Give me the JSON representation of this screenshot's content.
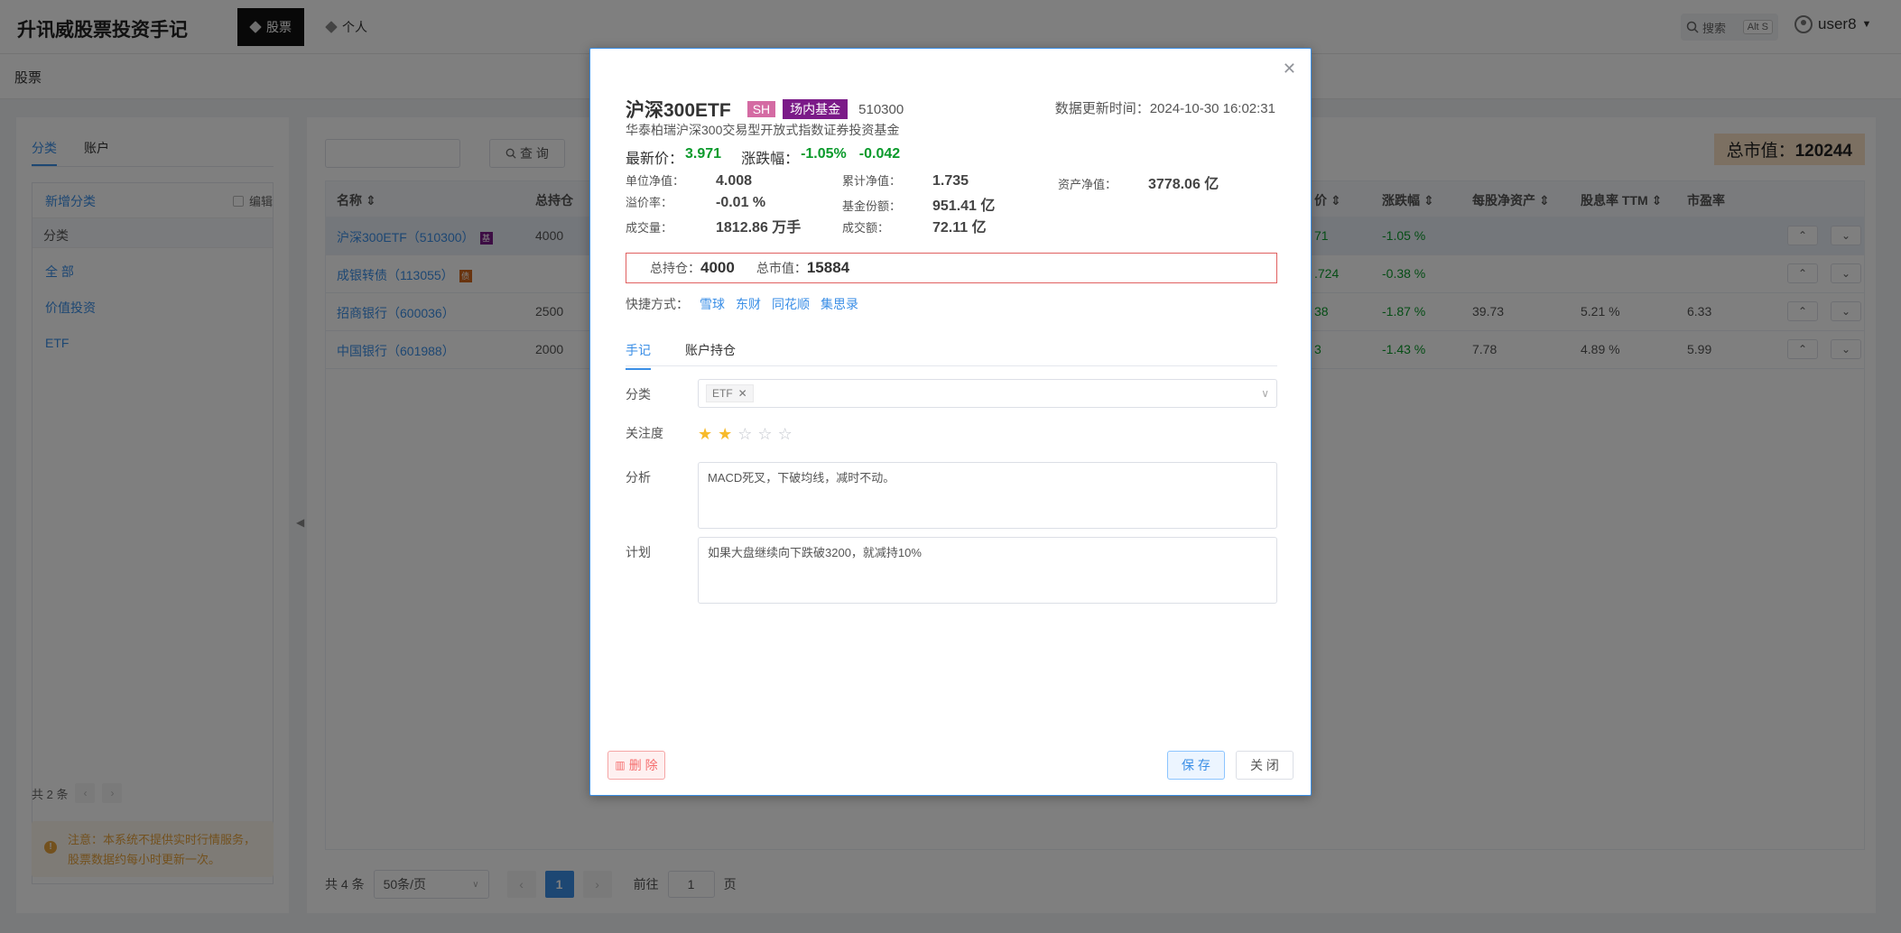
{
  "app": {
    "title": "升讯威股票投资手记"
  },
  "nav": {
    "tabs": [
      {
        "label": "股票"
      },
      {
        "label": "个人"
      }
    ]
  },
  "search": {
    "label": "搜索",
    "shortcut": "Alt S"
  },
  "user": {
    "name": "user8"
  },
  "breadcrumb": {
    "current": "股票"
  },
  "left": {
    "tabs": [
      {
        "label": "分类"
      },
      {
        "label": "账户"
      }
    ],
    "add_category": "新增分类",
    "edit_label": "编辑",
    "group_header": "分类",
    "items": [
      {
        "label": "全 部"
      },
      {
        "label": "价值投资"
      },
      {
        "label": "ETF"
      }
    ],
    "total": "共 2 条",
    "notice": "注意：本系统不提供实时行情服务，股票数据约每小时更新一次。"
  },
  "right": {
    "query_button": "查 询",
    "total_label": "总市值：",
    "total_value": "120244",
    "columns": [
      {
        "label": "名称"
      },
      {
        "label": "总持仓"
      },
      {
        "label": "价"
      },
      {
        "label": "涨跌幅"
      },
      {
        "label": "每股净资产"
      },
      {
        "label": "股息率 TTM"
      },
      {
        "label": "市盈率"
      }
    ],
    "rows": [
      {
        "name": "沪深300ETF（510300）",
        "tag": "基",
        "tag_color": "#7b1a88",
        "holding": "4000",
        "price": "71",
        "change": "-1.05 %",
        "nav": "",
        "dividend": "",
        "pe": ""
      },
      {
        "name": "成银转债（113055）",
        "tag": "债",
        "tag_color": "#d2691e",
        "holding": "",
        "price": ".724",
        "change": "-0.38 %",
        "nav": "",
        "dividend": "",
        "pe": ""
      },
      {
        "name": "招商银行（600036）",
        "tag": "",
        "tag_color": "",
        "holding": "2500",
        "price": "38",
        "change": "-1.87 %",
        "nav": "39.73",
        "dividend": "5.21 %",
        "pe": "6.33"
      },
      {
        "name": "中国银行（601988）",
        "tag": "",
        "tag_color": "",
        "holding": "2000",
        "price": "3",
        "change": "-1.43 %",
        "nav": "7.78",
        "dividend": "4.89 %",
        "pe": "5.99"
      }
    ],
    "pager": {
      "total": "共 4 条",
      "page_size": "50条/页",
      "current": "1",
      "goto_label": "前往",
      "goto_value": "1",
      "page_suffix": "页"
    }
  },
  "modal": {
    "name": "沪深300ETF",
    "badge_market": "SH",
    "badge_type": "场内基金",
    "code": "510300",
    "update_time": "数据更新时间：2024-10-30 16:02:31",
    "full_name": "华泰柏瑞沪深300交易型开放式指数证券投资基金",
    "price_label": "最新价：",
    "price": "3.971",
    "change_label": "涨跌幅：",
    "change_pct": "-1.05%",
    "change_amt": "-0.042",
    "stats": {
      "unit_nav_label": "单位净值：",
      "unit_nav": "4.008",
      "cum_nav_label": "累计净值：",
      "cum_nav": "1.735",
      "asset_nav_label": "资产净值：",
      "asset_nav": "3778.06 亿",
      "premium_label": "溢价率：",
      "premium": "-0.01 %",
      "shares_label": "基金份额：",
      "shares": "951.41 亿",
      "volume_label": "成交量：",
      "volume": "1812.86 万手",
      "turnover_label": "成交额：",
      "turnover": "72.11 亿"
    },
    "holding_label": "总持仓：",
    "holding": "4000",
    "market_value_label": "总市值：",
    "market_value": "15884",
    "quick_label": "快捷方式：",
    "quick_links": [
      {
        "label": "雪球"
      },
      {
        "label": "东财"
      },
      {
        "label": "同花顺"
      },
      {
        "label": "集思录"
      }
    ],
    "tabs": [
      {
        "label": "手记"
      },
      {
        "label": "账户持仓"
      }
    ],
    "category_label": "分类",
    "category_tag": "ETF",
    "attention_label": "关注度",
    "attention_rating": 2,
    "attention_max": 5,
    "analysis_label": "分析",
    "analysis_text": "MACD死叉，下破均线，减时不动。",
    "plan_label": "计划",
    "plan_text": "如果大盘继续向下跌破3200，就减持10%",
    "delete_button": "删 除",
    "save_button": "保 存",
    "close_button": "关 闭"
  }
}
